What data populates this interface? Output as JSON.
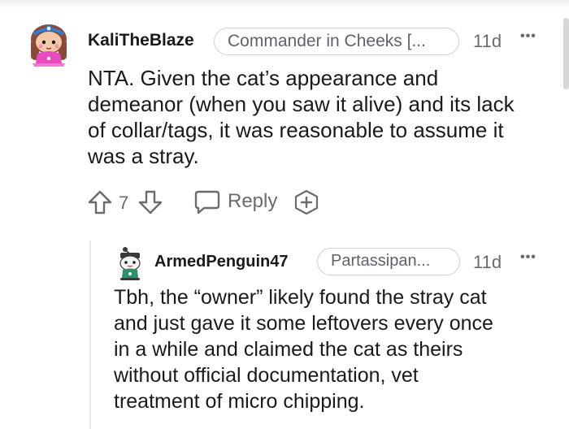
{
  "comments": [
    {
      "username": "KaliTheBlaze",
      "flair": "Commander in Cheeks [...",
      "time": "11d",
      "more": "•••",
      "body_lines": [
        "NTA. Given the cat’s appearance and",
        "demeanor (when you saw it alive) and its lack",
        "of collar/tags, it was reasonable to assume it",
        "was a stray."
      ],
      "score": "7",
      "reply_label": "Reply"
    },
    {
      "username": "ArmedPenguin47",
      "flair": "Partassipan...",
      "time": "11d",
      "more": "•••",
      "body_lines": [
        "Tbh, the “owner” likely found the stray cat",
        "and just gave it some leftovers every once",
        "in a while and claimed the cat as theirs",
        "without official documentation, vet",
        "treatment of micro chipping."
      ]
    }
  ],
  "icons": {
    "upvote": "upvote-arrow-icon",
    "downvote": "downvote-arrow-icon",
    "reply": "chat-bubble-icon",
    "award": "add-award-icon",
    "more": "more-options-icon"
  },
  "colors": {
    "text": "#1a1a1b",
    "meta": "#6b6b6b",
    "flair_border": "#cfcfcf",
    "avatar_skin": "#f2c9a8",
    "avatar_hair": "#8a4a3a",
    "avatar_pink": "#e84bbf",
    "avatar_headband": "#2a7fd4"
  }
}
